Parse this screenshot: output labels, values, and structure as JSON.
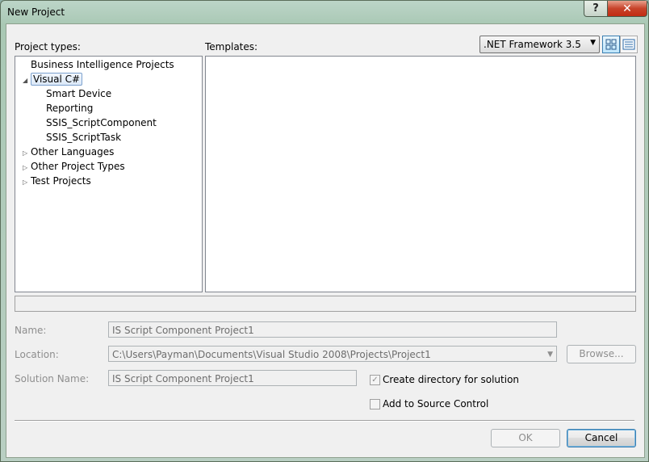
{
  "window": {
    "title": "New Project",
    "help_glyph": "?",
    "close_glyph": "✕"
  },
  "labels": {
    "project_types": "Project types:",
    "templates": "Templates:",
    "name": "Name:",
    "location": "Location:",
    "solution_name": "Solution Name:"
  },
  "framework": {
    "selected": ".NET Framework 3.5"
  },
  "tree": [
    {
      "label": "Business Intelligence Projects",
      "level": 0,
      "arrow": ""
    },
    {
      "label": "Visual C#",
      "level": 0,
      "arrow": "◢",
      "selected": true
    },
    {
      "label": "Smart Device",
      "level": 1,
      "arrow": ""
    },
    {
      "label": "Reporting",
      "level": 1,
      "arrow": ""
    },
    {
      "label": "SSIS_ScriptComponent",
      "level": 1,
      "arrow": ""
    },
    {
      "label": "SSIS_ScriptTask",
      "level": 1,
      "arrow": ""
    },
    {
      "label": "Other Languages",
      "level": 0,
      "arrow": "▷"
    },
    {
      "label": "Other Project Types",
      "level": 0,
      "arrow": "▷"
    },
    {
      "label": "Test Projects",
      "level": 0,
      "arrow": "▷"
    }
  ],
  "fields": {
    "name_value": "IS Script Component Project1",
    "location_value": "C:\\Users\\Payman\\Documents\\Visual Studio 2008\\Projects\\Project1",
    "solution_value": "IS Script Component Project1"
  },
  "checkboxes": {
    "create_directory": {
      "label": "Create directory for solution",
      "checked": true,
      "mark": "✓"
    },
    "source_control": {
      "label": "Add to Source Control",
      "checked": false,
      "mark": ""
    }
  },
  "buttons": {
    "browse": "Browse...",
    "ok": "OK",
    "cancel": "Cancel"
  }
}
